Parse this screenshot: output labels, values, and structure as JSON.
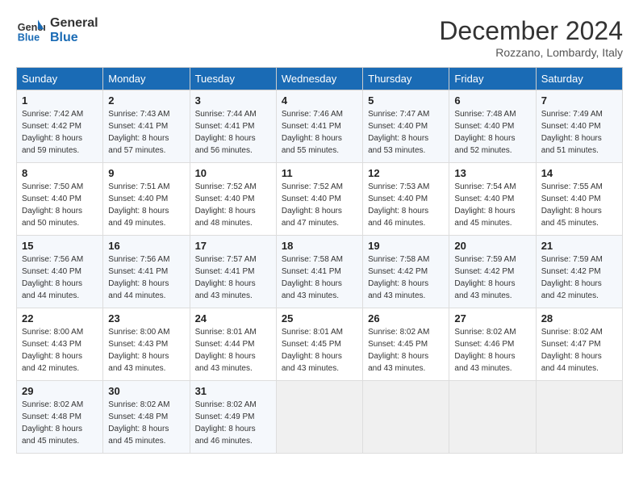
{
  "header": {
    "logo_line1": "General",
    "logo_line2": "Blue",
    "month": "December 2024",
    "location": "Rozzano, Lombardy, Italy"
  },
  "weekdays": [
    "Sunday",
    "Monday",
    "Tuesday",
    "Wednesday",
    "Thursday",
    "Friday",
    "Saturday"
  ],
  "weeks": [
    [
      {
        "day": "1",
        "sunrise": "Sunrise: 7:42 AM",
        "sunset": "Sunset: 4:42 PM",
        "daylight": "Daylight: 8 hours and 59 minutes."
      },
      {
        "day": "2",
        "sunrise": "Sunrise: 7:43 AM",
        "sunset": "Sunset: 4:41 PM",
        "daylight": "Daylight: 8 hours and 57 minutes."
      },
      {
        "day": "3",
        "sunrise": "Sunrise: 7:44 AM",
        "sunset": "Sunset: 4:41 PM",
        "daylight": "Daylight: 8 hours and 56 minutes."
      },
      {
        "day": "4",
        "sunrise": "Sunrise: 7:46 AM",
        "sunset": "Sunset: 4:41 PM",
        "daylight": "Daylight: 8 hours and 55 minutes."
      },
      {
        "day": "5",
        "sunrise": "Sunrise: 7:47 AM",
        "sunset": "Sunset: 4:40 PM",
        "daylight": "Daylight: 8 hours and 53 minutes."
      },
      {
        "day": "6",
        "sunrise": "Sunrise: 7:48 AM",
        "sunset": "Sunset: 4:40 PM",
        "daylight": "Daylight: 8 hours and 52 minutes."
      },
      {
        "day": "7",
        "sunrise": "Sunrise: 7:49 AM",
        "sunset": "Sunset: 4:40 PM",
        "daylight": "Daylight: 8 hours and 51 minutes."
      }
    ],
    [
      {
        "day": "8",
        "sunrise": "Sunrise: 7:50 AM",
        "sunset": "Sunset: 4:40 PM",
        "daylight": "Daylight: 8 hours and 50 minutes."
      },
      {
        "day": "9",
        "sunrise": "Sunrise: 7:51 AM",
        "sunset": "Sunset: 4:40 PM",
        "daylight": "Daylight: 8 hours and 49 minutes."
      },
      {
        "day": "10",
        "sunrise": "Sunrise: 7:52 AM",
        "sunset": "Sunset: 4:40 PM",
        "daylight": "Daylight: 8 hours and 48 minutes."
      },
      {
        "day": "11",
        "sunrise": "Sunrise: 7:52 AM",
        "sunset": "Sunset: 4:40 PM",
        "daylight": "Daylight: 8 hours and 47 minutes."
      },
      {
        "day": "12",
        "sunrise": "Sunrise: 7:53 AM",
        "sunset": "Sunset: 4:40 PM",
        "daylight": "Daylight: 8 hours and 46 minutes."
      },
      {
        "day": "13",
        "sunrise": "Sunrise: 7:54 AM",
        "sunset": "Sunset: 4:40 PM",
        "daylight": "Daylight: 8 hours and 45 minutes."
      },
      {
        "day": "14",
        "sunrise": "Sunrise: 7:55 AM",
        "sunset": "Sunset: 4:40 PM",
        "daylight": "Daylight: 8 hours and 45 minutes."
      }
    ],
    [
      {
        "day": "15",
        "sunrise": "Sunrise: 7:56 AM",
        "sunset": "Sunset: 4:40 PM",
        "daylight": "Daylight: 8 hours and 44 minutes."
      },
      {
        "day": "16",
        "sunrise": "Sunrise: 7:56 AM",
        "sunset": "Sunset: 4:41 PM",
        "daylight": "Daylight: 8 hours and 44 minutes."
      },
      {
        "day": "17",
        "sunrise": "Sunrise: 7:57 AM",
        "sunset": "Sunset: 4:41 PM",
        "daylight": "Daylight: 8 hours and 43 minutes."
      },
      {
        "day": "18",
        "sunrise": "Sunrise: 7:58 AM",
        "sunset": "Sunset: 4:41 PM",
        "daylight": "Daylight: 8 hours and 43 minutes."
      },
      {
        "day": "19",
        "sunrise": "Sunrise: 7:58 AM",
        "sunset": "Sunset: 4:42 PM",
        "daylight": "Daylight: 8 hours and 43 minutes."
      },
      {
        "day": "20",
        "sunrise": "Sunrise: 7:59 AM",
        "sunset": "Sunset: 4:42 PM",
        "daylight": "Daylight: 8 hours and 43 minutes."
      },
      {
        "day": "21",
        "sunrise": "Sunrise: 7:59 AM",
        "sunset": "Sunset: 4:42 PM",
        "daylight": "Daylight: 8 hours and 42 minutes."
      }
    ],
    [
      {
        "day": "22",
        "sunrise": "Sunrise: 8:00 AM",
        "sunset": "Sunset: 4:43 PM",
        "daylight": "Daylight: 8 hours and 42 minutes."
      },
      {
        "day": "23",
        "sunrise": "Sunrise: 8:00 AM",
        "sunset": "Sunset: 4:43 PM",
        "daylight": "Daylight: 8 hours and 43 minutes."
      },
      {
        "day": "24",
        "sunrise": "Sunrise: 8:01 AM",
        "sunset": "Sunset: 4:44 PM",
        "daylight": "Daylight: 8 hours and 43 minutes."
      },
      {
        "day": "25",
        "sunrise": "Sunrise: 8:01 AM",
        "sunset": "Sunset: 4:45 PM",
        "daylight": "Daylight: 8 hours and 43 minutes."
      },
      {
        "day": "26",
        "sunrise": "Sunrise: 8:02 AM",
        "sunset": "Sunset: 4:45 PM",
        "daylight": "Daylight: 8 hours and 43 minutes."
      },
      {
        "day": "27",
        "sunrise": "Sunrise: 8:02 AM",
        "sunset": "Sunset: 4:46 PM",
        "daylight": "Daylight: 8 hours and 43 minutes."
      },
      {
        "day": "28",
        "sunrise": "Sunrise: 8:02 AM",
        "sunset": "Sunset: 4:47 PM",
        "daylight": "Daylight: 8 hours and 44 minutes."
      }
    ],
    [
      {
        "day": "29",
        "sunrise": "Sunrise: 8:02 AM",
        "sunset": "Sunset: 4:48 PM",
        "daylight": "Daylight: 8 hours and 45 minutes."
      },
      {
        "day": "30",
        "sunrise": "Sunrise: 8:02 AM",
        "sunset": "Sunset: 4:48 PM",
        "daylight": "Daylight: 8 hours and 45 minutes."
      },
      {
        "day": "31",
        "sunrise": "Sunrise: 8:02 AM",
        "sunset": "Sunset: 4:49 PM",
        "daylight": "Daylight: 8 hours and 46 minutes."
      },
      null,
      null,
      null,
      null
    ]
  ]
}
